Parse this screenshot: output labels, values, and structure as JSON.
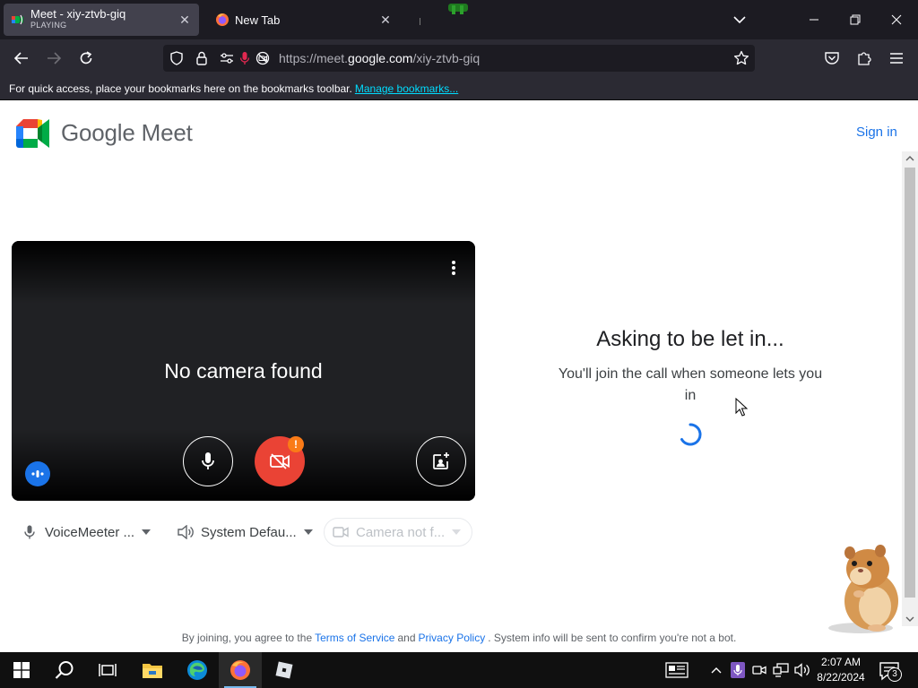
{
  "browser": {
    "tabs": [
      {
        "title": "Meet - xiy-ztvb-giq",
        "subtitle": "PLAYING",
        "active": true
      },
      {
        "title": "New Tab",
        "active": false
      }
    ],
    "url": {
      "prefix": "https://meet.",
      "domain": "google.com",
      "path": "/xiy-ztvb-giq"
    },
    "bookmarks_bar": {
      "text": "For quick access, place your bookmarks here on the bookmarks toolbar.",
      "link": "Manage bookmarks..."
    }
  },
  "meet": {
    "brand": "Google Meet",
    "sign_in": "Sign in",
    "preview": {
      "message": "No camera found",
      "camera_warning": "!"
    },
    "devices": {
      "microphone": "VoiceMeeter ...",
      "speaker": "System Defau...",
      "camera": "Camera not f..."
    },
    "status": {
      "title": "Asking to be let in...",
      "subtitle": "You'll join the call when someone lets you in"
    },
    "terms": {
      "prefix": "By joining, you agree to the",
      "tos": "Terms of Service",
      "and": "and",
      "privacy": "Privacy Policy",
      "suffix": ". System info will be sent to confirm you're not a bot."
    }
  },
  "taskbar": {
    "time": "2:07 AM",
    "date": "8/22/2024",
    "notification_count": "3"
  },
  "colors": {
    "meet_blue": "#1a73e8",
    "cam_off_red": "#ea4335",
    "warning_orange": "#fa7b17",
    "firefox_chrome": "#2b2a33",
    "tab_strip": "#1c1b22"
  }
}
